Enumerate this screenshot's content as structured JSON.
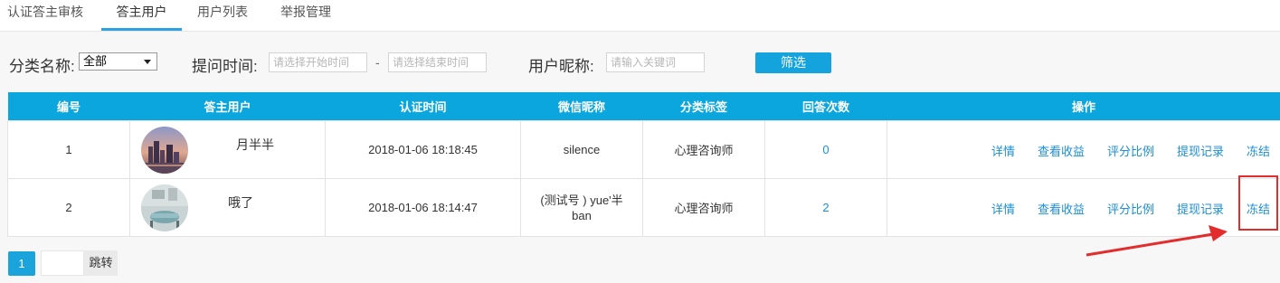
{
  "tabs": [
    {
      "label": "认证答主审核",
      "active": false
    },
    {
      "label": "答主用户",
      "active": true
    },
    {
      "label": "用户列表",
      "active": false
    },
    {
      "label": "举报管理",
      "active": false
    }
  ],
  "filter": {
    "category_label": "分类名称:",
    "category_value": "全部",
    "time_label": "提问时间:",
    "start_placeholder": "请选择开始时间",
    "dash": "-",
    "end_placeholder": "请选择结束时间",
    "nick_label": "用户昵称:",
    "nick_placeholder": "请输入关键词",
    "button": "筛选"
  },
  "table": {
    "headers": [
      "编号",
      "答主用户",
      "认证时间",
      "微信昵称",
      "分类标签",
      "回答次数",
      "操作"
    ],
    "rows": [
      {
        "id": "1",
        "user": "月半半",
        "time": "2018-01-06 18:18:45",
        "wechat": "silence",
        "category": "心理咨询师",
        "answers": "0"
      },
      {
        "id": "2",
        "user": "哦了",
        "time": "2018-01-06 18:14:47",
        "wechat": "(测试号 ) yue'半 ban",
        "category": "心理咨询师",
        "answers": "2"
      }
    ],
    "actions": [
      "详情",
      "查看收益",
      "评分比例",
      "提现记录",
      "冻结"
    ]
  },
  "pagination": {
    "current": "1",
    "jump": "跳转"
  },
  "colors": {
    "accent": "#0ca6de",
    "link": "#1a8fd4",
    "annotation": "#e32c2c"
  }
}
